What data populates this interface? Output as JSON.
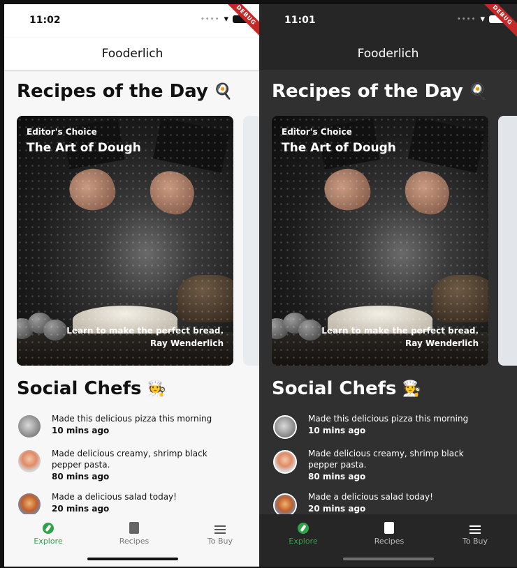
{
  "app": {
    "title": "Fooderlich"
  },
  "screens": [
    {
      "theme": "light",
      "time": "11:02",
      "debug_label": "DEBUG",
      "recipes_heading": "Recipes of the Day",
      "recipes_emoji": "🍳",
      "card": {
        "tag": "Editor's Choice",
        "title": "The Art of Dough",
        "description": "Learn to make the perfect bread.",
        "author": "Ray Wenderlich"
      },
      "social_heading": "Social Chefs",
      "social_emoji": "🧑‍🍳",
      "feed": [
        {
          "text": "Made this delicious pizza this morning",
          "time": "10 mins ago"
        },
        {
          "text": "Made delicious creamy, shrimp black pepper pasta.",
          "time": "80 mins ago"
        },
        {
          "text": "Made a delicious salad today!",
          "time": "20 mins ago"
        }
      ],
      "nav": {
        "explore": "Explore",
        "recipes": "Recipes",
        "to_buy": "To Buy"
      }
    },
    {
      "theme": "dark",
      "time": "11:01",
      "debug_label": "DEBUG",
      "recipes_heading": "Recipes of the Day",
      "recipes_emoji": "🍳",
      "card": {
        "tag": "Editor's Choice",
        "title": "The Art of Dough",
        "description": "Learn to make the perfect bread.",
        "author": "Ray Wenderlich"
      },
      "social_heading": "Social Chefs",
      "social_emoji": "🧑‍🍳",
      "feed": [
        {
          "text": "Made this delicious pizza this morning",
          "time": "10 mins ago"
        },
        {
          "text": "Made delicious creamy, shrimp black pepper pasta.",
          "time": "80 mins ago"
        },
        {
          "text": "Made a delicious salad today!",
          "time": "20 mins ago"
        }
      ],
      "nav": {
        "explore": "Explore",
        "recipes": "Recipes",
        "to_buy": "To Buy"
      }
    }
  ],
  "colors": {
    "accent_green": "#2fa34a",
    "dark_background": "#303030",
    "light_background": "#f7f7f7"
  }
}
